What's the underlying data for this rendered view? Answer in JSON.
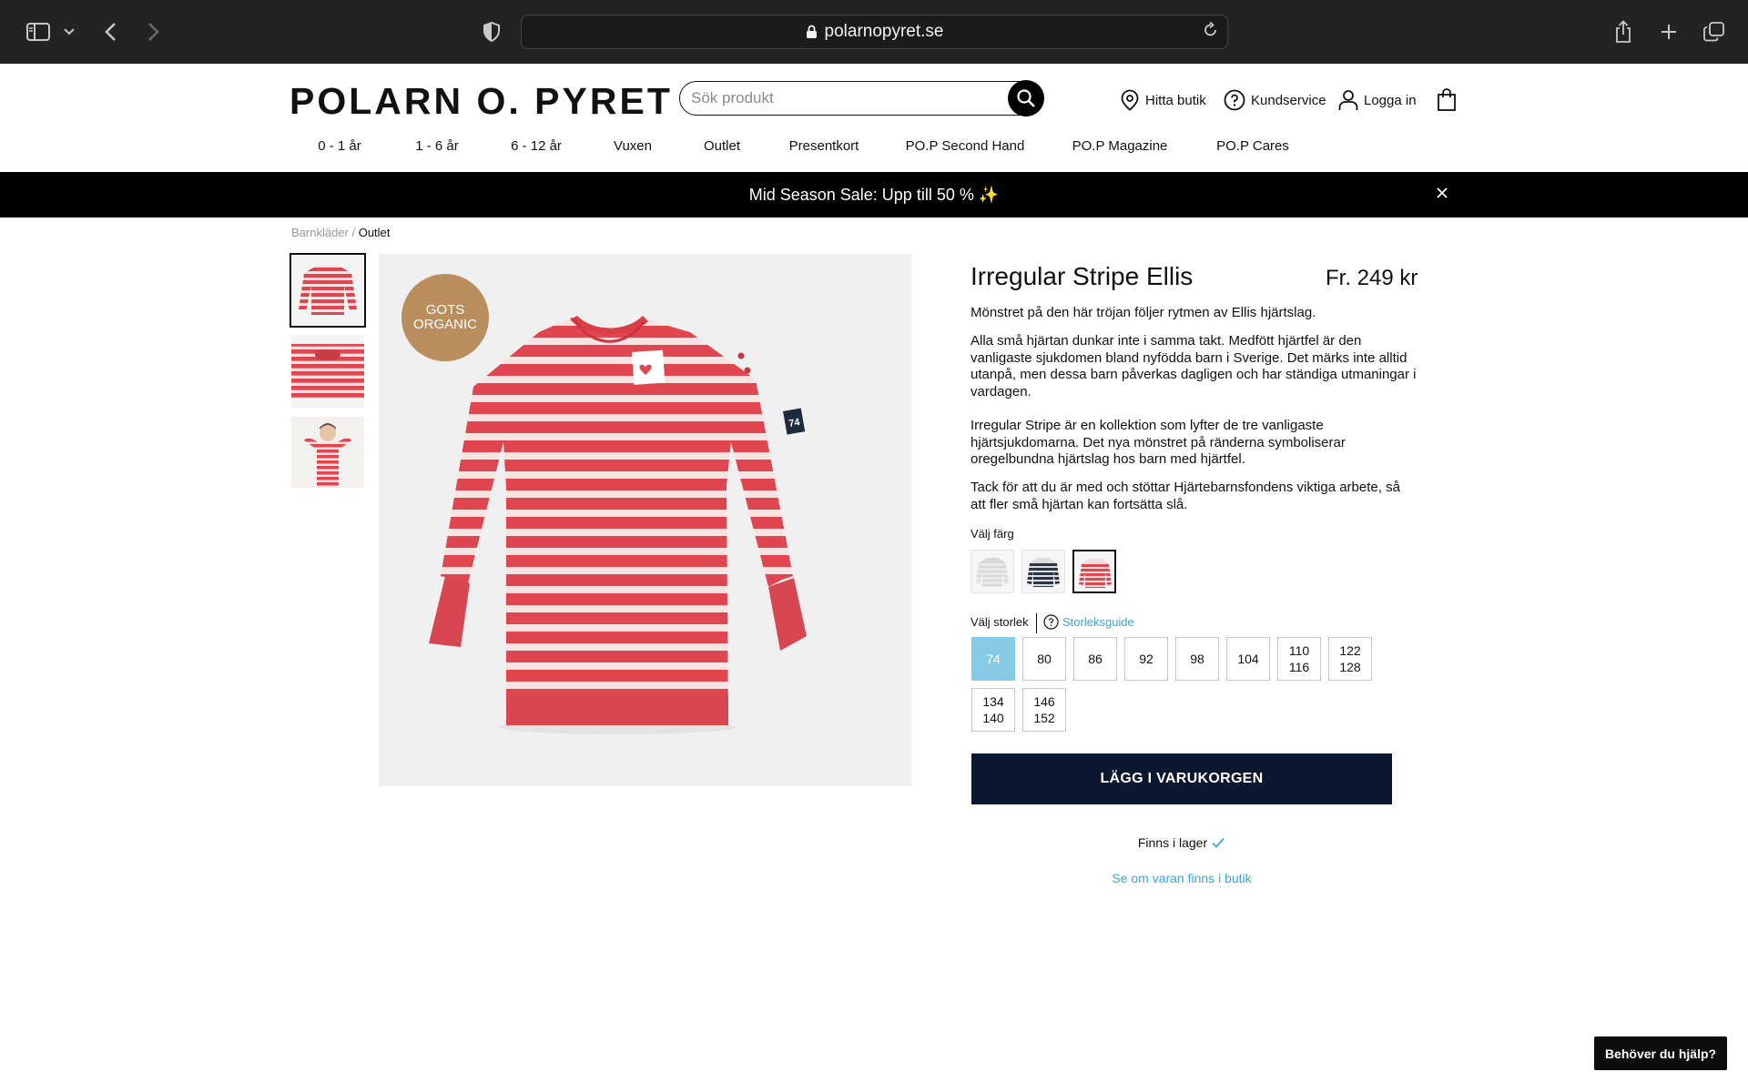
{
  "browser": {
    "url": "polarnopyret.se"
  },
  "header": {
    "logo": "POLARN O. PYRET",
    "search_placeholder": "Sök produkt",
    "links": {
      "store": "Hitta butik",
      "service": "Kundservice",
      "login": "Logga in"
    }
  },
  "nav": [
    "0 - 1 år",
    "1 - 6 år",
    "6 - 12 år",
    "Vuxen",
    "Outlet",
    "Presentkort",
    "PO.P Second Hand",
    "PO.P Magazine",
    "PO.P Cares"
  ],
  "promo": "Mid Season Sale: Upp till 50 % ✨",
  "breadcrumb": {
    "first": "Barnkläder",
    "separator": " / ",
    "current": "Outlet"
  },
  "badge": {
    "line1": "GOTS",
    "line2": "ORGANIC"
  },
  "product": {
    "title": "Irregular Stripe Ellis",
    "price": "Fr. 249 kr",
    "paragraphs": [
      "Mönstret på den här tröjan följer rytmen av Ellis hjärtslag.",
      "Alla små hjärtan dunkar inte i samma takt. Medfött hjärtfel är den vanligaste sjukdomen bland nyfödda barn i Sverige. Det märks inte alltid utanpå, men dessa barn påverkas dagligen och har ständiga utmaningar i vardagen.",
      "Irregular Stripe är en kollektion som lyfter de tre vanligaste hjärtsjukdomarna. Det nya mönstret på ränderna symboliserar oregelbundna hjärtslag hos barn med hjärtfel.",
      "Tack för att du är med och stöttar Hjärtebarnsfondens viktiga arbete, så att fler små hjärtan kan fortsätta slå."
    ],
    "color_label": "Välj färg",
    "colors": [
      {
        "name": "white",
        "stripe": "#e9e9e7",
        "base": "#d8d8d6"
      },
      {
        "name": "navy",
        "stripe": "#2c3547",
        "base": "#dedede"
      },
      {
        "name": "red",
        "stripe": "#e0464f",
        "base": "#f3dede"
      }
    ],
    "selected_color": 2,
    "size_label": "Välj storlek",
    "size_guide": "Storleksguide",
    "sizes": [
      [
        "74"
      ],
      [
        "80"
      ],
      [
        "86"
      ],
      [
        "92"
      ],
      [
        "98"
      ],
      [
        "104"
      ],
      [
        "110",
        "116"
      ],
      [
        "122",
        "128"
      ],
      [
        "134",
        "140"
      ],
      [
        "146",
        "152"
      ]
    ],
    "selected_size": 0,
    "add_to_cart": "LÄGG I VARUKORGEN",
    "stock": "Finns i lager",
    "store_link": "Se om varan finns i butik"
  },
  "help": "Behöver du hjälp?",
  "colors": {
    "accent": "#39a6d8",
    "size_selected": "#86cbe5",
    "cart_button": "#0c1830",
    "badge": "#b98d5d",
    "shirt_red": "#e0464f"
  }
}
